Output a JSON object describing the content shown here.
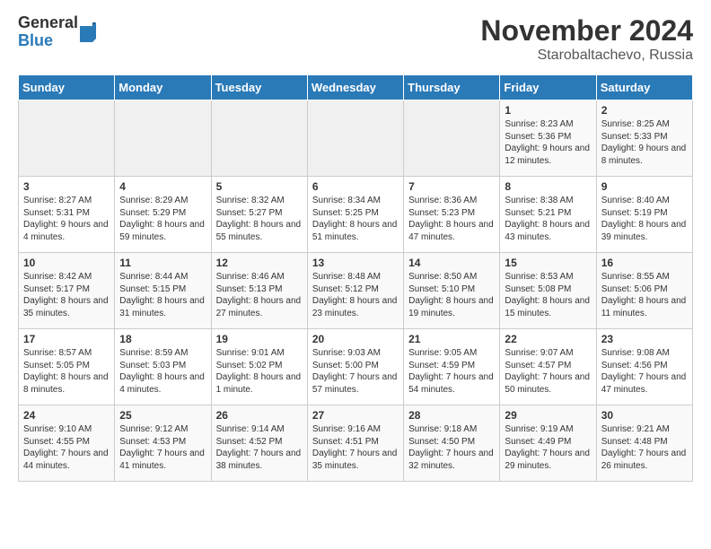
{
  "logo": {
    "line1": "General",
    "line2": "Blue"
  },
  "title": "November 2024",
  "subtitle": "Starobaltachevo, Russia",
  "headers": [
    "Sunday",
    "Monday",
    "Tuesday",
    "Wednesday",
    "Thursday",
    "Friday",
    "Saturday"
  ],
  "rows": [
    [
      {
        "day": "",
        "info": ""
      },
      {
        "day": "",
        "info": ""
      },
      {
        "day": "",
        "info": ""
      },
      {
        "day": "",
        "info": ""
      },
      {
        "day": "",
        "info": ""
      },
      {
        "day": "1",
        "info": "Sunrise: 8:23 AM\nSunset: 5:36 PM\nDaylight: 9 hours and 12 minutes."
      },
      {
        "day": "2",
        "info": "Sunrise: 8:25 AM\nSunset: 5:33 PM\nDaylight: 9 hours and 8 minutes."
      }
    ],
    [
      {
        "day": "3",
        "info": "Sunrise: 8:27 AM\nSunset: 5:31 PM\nDaylight: 9 hours and 4 minutes."
      },
      {
        "day": "4",
        "info": "Sunrise: 8:29 AM\nSunset: 5:29 PM\nDaylight: 8 hours and 59 minutes."
      },
      {
        "day": "5",
        "info": "Sunrise: 8:32 AM\nSunset: 5:27 PM\nDaylight: 8 hours and 55 minutes."
      },
      {
        "day": "6",
        "info": "Sunrise: 8:34 AM\nSunset: 5:25 PM\nDaylight: 8 hours and 51 minutes."
      },
      {
        "day": "7",
        "info": "Sunrise: 8:36 AM\nSunset: 5:23 PM\nDaylight: 8 hours and 47 minutes."
      },
      {
        "day": "8",
        "info": "Sunrise: 8:38 AM\nSunset: 5:21 PM\nDaylight: 8 hours and 43 minutes."
      },
      {
        "day": "9",
        "info": "Sunrise: 8:40 AM\nSunset: 5:19 PM\nDaylight: 8 hours and 39 minutes."
      }
    ],
    [
      {
        "day": "10",
        "info": "Sunrise: 8:42 AM\nSunset: 5:17 PM\nDaylight: 8 hours and 35 minutes."
      },
      {
        "day": "11",
        "info": "Sunrise: 8:44 AM\nSunset: 5:15 PM\nDaylight: 8 hours and 31 minutes."
      },
      {
        "day": "12",
        "info": "Sunrise: 8:46 AM\nSunset: 5:13 PM\nDaylight: 8 hours and 27 minutes."
      },
      {
        "day": "13",
        "info": "Sunrise: 8:48 AM\nSunset: 5:12 PM\nDaylight: 8 hours and 23 minutes."
      },
      {
        "day": "14",
        "info": "Sunrise: 8:50 AM\nSunset: 5:10 PM\nDaylight: 8 hours and 19 minutes."
      },
      {
        "day": "15",
        "info": "Sunrise: 8:53 AM\nSunset: 5:08 PM\nDaylight: 8 hours and 15 minutes."
      },
      {
        "day": "16",
        "info": "Sunrise: 8:55 AM\nSunset: 5:06 PM\nDaylight: 8 hours and 11 minutes."
      }
    ],
    [
      {
        "day": "17",
        "info": "Sunrise: 8:57 AM\nSunset: 5:05 PM\nDaylight: 8 hours and 8 minutes."
      },
      {
        "day": "18",
        "info": "Sunrise: 8:59 AM\nSunset: 5:03 PM\nDaylight: 8 hours and 4 minutes."
      },
      {
        "day": "19",
        "info": "Sunrise: 9:01 AM\nSunset: 5:02 PM\nDaylight: 8 hours and 1 minute."
      },
      {
        "day": "20",
        "info": "Sunrise: 9:03 AM\nSunset: 5:00 PM\nDaylight: 7 hours and 57 minutes."
      },
      {
        "day": "21",
        "info": "Sunrise: 9:05 AM\nSunset: 4:59 PM\nDaylight: 7 hours and 54 minutes."
      },
      {
        "day": "22",
        "info": "Sunrise: 9:07 AM\nSunset: 4:57 PM\nDaylight: 7 hours and 50 minutes."
      },
      {
        "day": "23",
        "info": "Sunrise: 9:08 AM\nSunset: 4:56 PM\nDaylight: 7 hours and 47 minutes."
      }
    ],
    [
      {
        "day": "24",
        "info": "Sunrise: 9:10 AM\nSunset: 4:55 PM\nDaylight: 7 hours and 44 minutes."
      },
      {
        "day": "25",
        "info": "Sunrise: 9:12 AM\nSunset: 4:53 PM\nDaylight: 7 hours and 41 minutes."
      },
      {
        "day": "26",
        "info": "Sunrise: 9:14 AM\nSunset: 4:52 PM\nDaylight: 7 hours and 38 minutes."
      },
      {
        "day": "27",
        "info": "Sunrise: 9:16 AM\nSunset: 4:51 PM\nDaylight: 7 hours and 35 minutes."
      },
      {
        "day": "28",
        "info": "Sunrise: 9:18 AM\nSunset: 4:50 PM\nDaylight: 7 hours and 32 minutes."
      },
      {
        "day": "29",
        "info": "Sunrise: 9:19 AM\nSunset: 4:49 PM\nDaylight: 7 hours and 29 minutes."
      },
      {
        "day": "30",
        "info": "Sunrise: 9:21 AM\nSunset: 4:48 PM\nDaylight: 7 hours and 26 minutes."
      }
    ]
  ]
}
